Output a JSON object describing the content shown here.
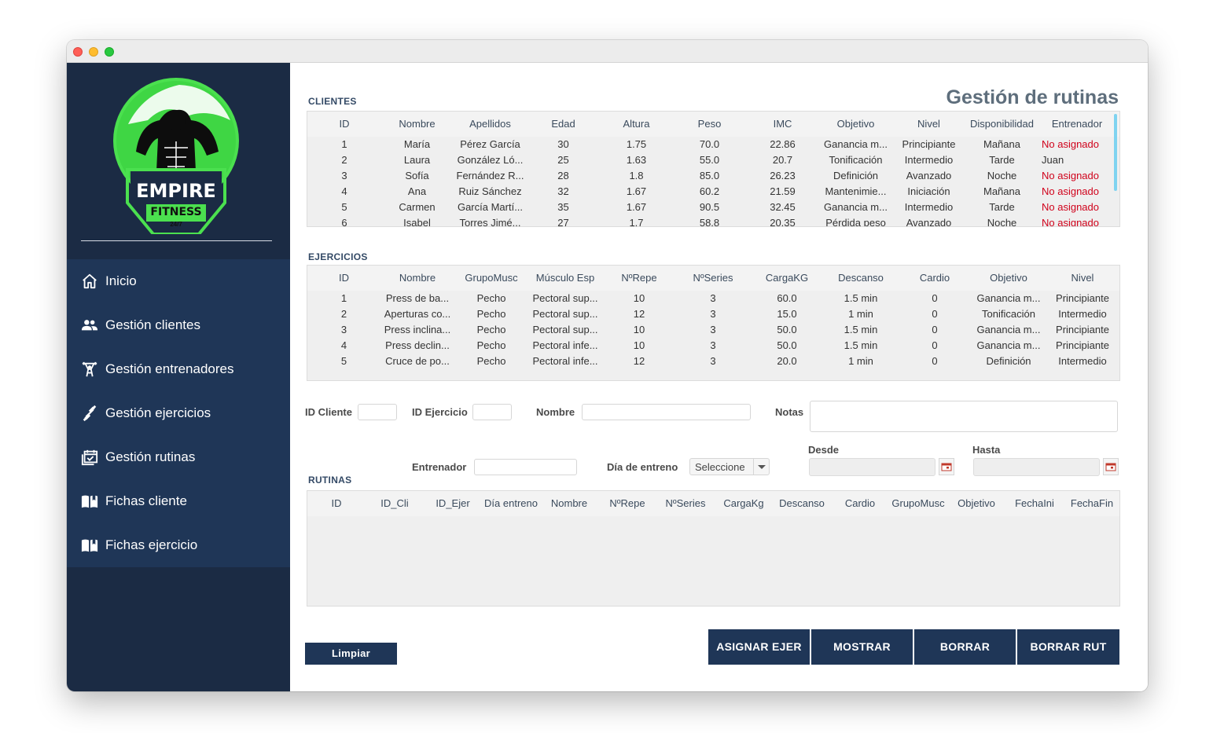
{
  "logo": {
    "line1": "EMPIRE",
    "line2": "FITNESS",
    "line3": "24/7"
  },
  "menu": [
    {
      "label": "Inicio",
      "icon": "home-icon"
    },
    {
      "label": "Gestión clientes",
      "icon": "users-icon"
    },
    {
      "label": "Gestión entrenadores",
      "icon": "weightlifter-icon"
    },
    {
      "label": "Gestión ejercicios",
      "icon": "dumbbell-icon"
    },
    {
      "label": "Gestión rutinas",
      "icon": "calendar-check-icon"
    },
    {
      "label": "Fichas cliente",
      "icon": "book-icon"
    },
    {
      "label": "Fichas ejercicio",
      "icon": "book-icon"
    }
  ],
  "page_title": "Gestión de rutinas",
  "clientes": {
    "label": "CLIENTES",
    "columns": [
      "ID",
      "Nombre",
      "Apellidos",
      "Edad",
      "Altura",
      "Peso",
      "IMC",
      "Objetivo",
      "Nivel",
      "Disponibilidad",
      "Entrenador"
    ],
    "rows": [
      [
        "1",
        "María",
        "Pérez García",
        "30",
        "1.75",
        "70.0",
        "22.86",
        "Ganancia m...",
        "Principiante",
        "Mañana",
        "No asignado"
      ],
      [
        "2",
        "Laura",
        "González Ló...",
        "25",
        "1.63",
        "55.0",
        "20.7",
        "Tonificación",
        "Intermedio",
        "Tarde",
        "Juan"
      ],
      [
        "3",
        "Sofía",
        "Fernández R...",
        "28",
        "1.8",
        "85.0",
        "26.23",
        "Definición",
        "Avanzado",
        "Noche",
        "No asignado"
      ],
      [
        "4",
        "Ana",
        "Ruiz Sánchez",
        "32",
        "1.67",
        "60.2",
        "21.59",
        "Mantenimie...",
        "Iniciación",
        "Mañana",
        "No asignado"
      ],
      [
        "5",
        "Carmen",
        "García Martí...",
        "35",
        "1.67",
        "90.5",
        "32.45",
        "Ganancia m...",
        "Intermedio",
        "Tarde",
        "No asignado"
      ],
      [
        "6",
        "Isabel",
        "Torres Jimé...",
        "27",
        "1.7",
        "58.8",
        "20.35",
        "Pérdida peso",
        "Avanzado",
        "Noche",
        "No asignado"
      ]
    ]
  },
  "ejercicios": {
    "label": "EJERCICIOS",
    "columns": [
      "ID",
      "Nombre",
      "GrupoMusc",
      "Músculo Esp",
      "NºRepe",
      "NºSeries",
      "CargaKG",
      "Descanso",
      "Cardio",
      "Objetivo",
      "Nivel"
    ],
    "rows": [
      [
        "1",
        "Press de ba...",
        "Pecho",
        "Pectoral sup...",
        "10",
        "3",
        "60.0",
        "1.5 min",
        "0",
        "Ganancia m...",
        "Principiante"
      ],
      [
        "2",
        "Aperturas co...",
        "Pecho",
        "Pectoral sup...",
        "12",
        "3",
        "15.0",
        "1 min",
        "0",
        "Tonificación",
        "Intermedio"
      ],
      [
        "3",
        "Press inclina...",
        "Pecho",
        "Pectoral sup...",
        "10",
        "3",
        "50.0",
        "1.5 min",
        "0",
        "Ganancia m...",
        "Principiante"
      ],
      [
        "4",
        "Press declin...",
        "Pecho",
        "Pectoral infe...",
        "10",
        "3",
        "50.0",
        "1.5 min",
        "0",
        "Ganancia m...",
        "Principiante"
      ],
      [
        "5",
        "Cruce de po...",
        "Pecho",
        "Pectoral infe...",
        "12",
        "3",
        "20.0",
        "1 min",
        "0",
        "Definición",
        "Intermedio"
      ]
    ]
  },
  "form": {
    "id_cliente_label": "ID Cliente",
    "id_ejercicio_label": "ID Ejercicio",
    "nombre_label": "Nombre",
    "notas_label": "Notas",
    "entrenador_label": "Entrenador",
    "dia_label": "Día de entreno",
    "dia_value": "Seleccione",
    "desde_label": "Desde",
    "hasta_label": "Hasta",
    "id_cliente_value": "",
    "id_ejercicio_value": "",
    "nombre_value": "",
    "notas_value": "",
    "entrenador_value": "",
    "desde_value": "",
    "hasta_value": ""
  },
  "rutinas": {
    "label": "RUTINAS",
    "columns": [
      "ID",
      "ID_Cli",
      "ID_Ejer",
      "Día entreno",
      "Nombre",
      "NºRepe",
      "NºSeries",
      "CargaKg",
      "Descanso",
      "Cardio",
      "GrupoMusc",
      "Objetivo",
      "FechaIni",
      "FechaFin"
    ],
    "rows": []
  },
  "buttons": {
    "limpiar": "Limpiar",
    "asignar": "ASIGNAR EJER",
    "mostrar": "MOSTRAR",
    "borrar": "BORRAR",
    "borrar_rut": "BORRAR RUT"
  },
  "colors": {
    "sidebar": "#1b2b44",
    "menu": "#1f3657",
    "accent_green": "#4be04f",
    "alert_red": "#d0021b"
  }
}
